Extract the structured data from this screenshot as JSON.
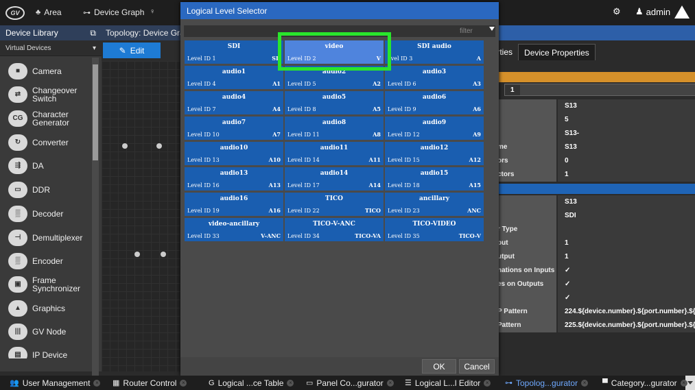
{
  "topbar": {
    "logo": "GV",
    "area_label": "Area",
    "graph_label": "Device Graph",
    "user": "admin"
  },
  "sidebar": {
    "title": "Device Library",
    "filter": "Virtual Devices",
    "items": [
      {
        "label": "Camera",
        "icon": "camera-icon",
        "glyph": "■"
      },
      {
        "label": "Changeover Switch",
        "icon": "changeover-icon",
        "glyph": "⇄"
      },
      {
        "label": "Character Generator",
        "icon": "cg-icon",
        "glyph": "CG"
      },
      {
        "label": "Converter",
        "icon": "converter-icon",
        "glyph": "↻"
      },
      {
        "label": "DA",
        "icon": "da-icon",
        "glyph": "⇶"
      },
      {
        "label": "DDR",
        "icon": "ddr-icon",
        "glyph": "▭"
      },
      {
        "label": "Decoder",
        "icon": "decoder-icon",
        "glyph": "▒"
      },
      {
        "label": "Demultiplexer",
        "icon": "demux-icon",
        "glyph": "⊣"
      },
      {
        "label": "Encoder",
        "icon": "encoder-icon",
        "glyph": "▒"
      },
      {
        "label": "Frame Synchronizer",
        "icon": "framesync-icon",
        "glyph": "▣"
      },
      {
        "label": "Graphics",
        "icon": "graphics-icon",
        "glyph": "▲"
      },
      {
        "label": "GV Node",
        "icon": "gvnode-icon",
        "glyph": "|||"
      },
      {
        "label": "IP Device",
        "icon": "ipdevice-icon",
        "glyph": "▤"
      }
    ]
  },
  "topology": {
    "title": "Topology: Device Gra",
    "edit_label": "Edit"
  },
  "right_panel": {
    "tab_properties": "perties",
    "tab_device_properties": "Device Properties",
    "number": "1",
    "rows": [
      {
        "k": "",
        "v": "S13"
      },
      {
        "k": "",
        "v": "5"
      },
      {
        "k": "",
        "v": "S13-"
      },
      {
        "k": "me",
        "v": "S13"
      },
      {
        "k": "ors",
        "v": "0"
      },
      {
        "k": "ctors",
        "v": "1"
      },
      {
        "k": "",
        "v": "S13"
      },
      {
        "k": "",
        "v": "SDI"
      },
      {
        "k": "r Type",
        "v": ""
      },
      {
        "k": "put",
        "v": "1"
      },
      {
        "k": "utput",
        "v": "1"
      },
      {
        "k": "nations on Inputs",
        "v": "✓"
      },
      {
        "k": "es on Outputs",
        "v": "✓"
      },
      {
        "k": "",
        "v": "✓"
      },
      {
        "k": "P Pattern",
        "v": "224.${device.number}.${port.number}.${s"
      },
      {
        "k": "Pattern",
        "v": "225.${device.number}.${port.number}.${s"
      }
    ]
  },
  "modal": {
    "title": "Logical Level Selector",
    "filter_placeholder": "filter",
    "ok": "OK",
    "cancel": "Cancel",
    "tiles": [
      {
        "name": "SDI",
        "lid": "Level ID 1",
        "code": "SD"
      },
      {
        "name": "video",
        "lid": "Level ID 2",
        "code": "V",
        "selected": true
      },
      {
        "name": "SDI audio",
        "lid": "evel ID 3",
        "code": "A"
      },
      {
        "name": "audio1",
        "lid": "Level ID 4",
        "code": "A1"
      },
      {
        "name": "audio2",
        "lid": "Level ID 5",
        "code": "A2"
      },
      {
        "name": "audio3",
        "lid": "Level ID 6",
        "code": "A3"
      },
      {
        "name": "audio4",
        "lid": "Level ID 7",
        "code": "A4"
      },
      {
        "name": "audio5",
        "lid": "Level ID 8",
        "code": "A5"
      },
      {
        "name": "audio6",
        "lid": "Level ID 9",
        "code": "A6"
      },
      {
        "name": "audio7",
        "lid": "Level ID 10",
        "code": "A7"
      },
      {
        "name": "audio8",
        "lid": "Level ID 11",
        "code": "A8"
      },
      {
        "name": "audio9",
        "lid": "Level ID 12",
        "code": "A9"
      },
      {
        "name": "audio10",
        "lid": "Level ID 13",
        "code": "A10"
      },
      {
        "name": "audio11",
        "lid": "Level ID 14",
        "code": "A11"
      },
      {
        "name": "audio12",
        "lid": "Level ID 15",
        "code": "A12"
      },
      {
        "name": "audio13",
        "lid": "Level ID 16",
        "code": "A13"
      },
      {
        "name": "audio14",
        "lid": "Level ID 17",
        "code": "A14"
      },
      {
        "name": "audio15",
        "lid": "Level ID 18",
        "code": "A15"
      },
      {
        "name": "audio16",
        "lid": "Level ID 19",
        "code": "A16"
      },
      {
        "name": "TICO",
        "lid": "Level ID 22",
        "code": "TICO"
      },
      {
        "name": "ancillary",
        "lid": "Level ID 23",
        "code": "ANC"
      },
      {
        "name": "video-ancillary",
        "lid": "Level ID 33",
        "code": "V-ANC"
      },
      {
        "name": "TICO-V-ANC",
        "lid": "Level ID 34",
        "code": "TICO-VA"
      },
      {
        "name": "TICO-VIDEO",
        "lid": "Level ID 35",
        "code": "TICO-V"
      }
    ]
  },
  "taskbar": [
    {
      "label": "User Management",
      "icon": "users-icon",
      "glyph": "👥"
    },
    {
      "label": "Router Control",
      "icon": "router-grid-icon",
      "glyph": "▦"
    },
    {
      "label": "Logical ...ce Table",
      "icon": "logical-table-icon",
      "glyph": "G"
    },
    {
      "label": "Panel Co...gurator",
      "icon": "panel-icon",
      "glyph": "▭"
    },
    {
      "label": "Logical L...l Editor",
      "icon": "level-editor-icon",
      "glyph": "☰"
    },
    {
      "label": "Topolog...gurator",
      "icon": "topology-icon",
      "glyph": "⊶",
      "active": true
    },
    {
      "label": "Category...gurator",
      "icon": "category-icon",
      "glyph": "▀"
    }
  ],
  "colors": {
    "accent_blue": "#2a68c0",
    "tile_blue": "#1a5eb0",
    "selected_tile": "#4f84dd",
    "highlight_green": "#29e52c",
    "orange_bar": "#d5902a"
  }
}
